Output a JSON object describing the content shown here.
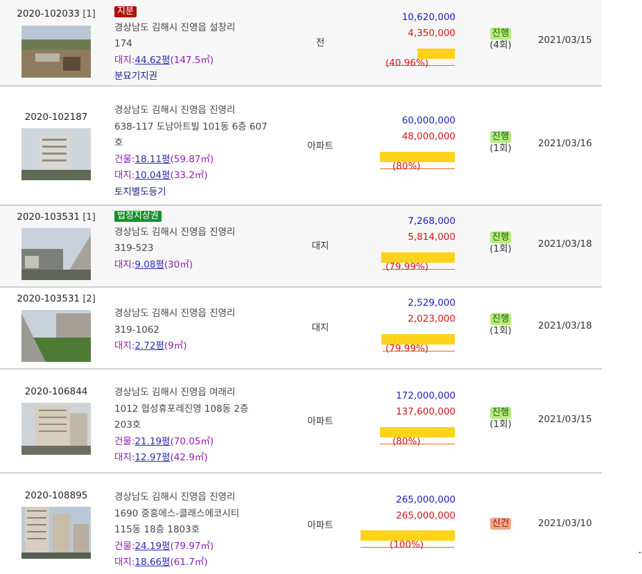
{
  "rows": [
    {
      "case": "2020-102033",
      "case_num": "[1]",
      "tag": "지분",
      "tag_color": "#b30f0f",
      "addr_lines": [
        "경상남도 김해시 진영읍 설창리",
        "174"
      ],
      "building_label": "",
      "building_pyeong": "",
      "building_m2": "",
      "land_label": "대지:",
      "land_pyeong": "44.62평",
      "land_m2": "(147.5㎡)",
      "note": "분묘기지권",
      "type": "전",
      "appraisal": "10,620,000",
      "min_bid": "4,350,000",
      "ratio": "(40.96%)",
      "status": "진행",
      "round": "(4회)",
      "date": "2021/03/15"
    },
    {
      "case": "2020-102187",
      "case_num": "",
      "tag": "",
      "addr_lines": [
        "경상남도 김해시 진영읍 진영리",
        "638-117 도남아트빌 101동 6층 607",
        "호"
      ],
      "building_label": "건물:",
      "building_pyeong": "18.11평",
      "building_m2": "(59.87㎡)",
      "land_label": "대지:",
      "land_pyeong": "10.04평",
      "land_m2": "(33.2㎡)",
      "note": "토지별도등기",
      "type": "아파트",
      "appraisal": "60,000,000",
      "min_bid": "48,000,000",
      "ratio": "(80%)",
      "status": "진행",
      "round": "(1회)",
      "date": "2021/03/16"
    },
    {
      "case": "2020-103531",
      "case_num": "[1]",
      "tag": "법정지상권",
      "tag_color": "#14932c",
      "addr_lines": [
        "경상남도 김해시 진영읍 진영리",
        "319-523"
      ],
      "land_label": "대지:",
      "land_pyeong": "9.08평",
      "land_m2": "(30㎡)",
      "type": "대지",
      "appraisal": "7,268,000",
      "min_bid": "5,814,000",
      "ratio": "(79.99%)",
      "status": "진행",
      "round": "(1회)",
      "date": "2021/03/18"
    },
    {
      "case": "2020-103531",
      "case_num": "[2]",
      "addr_lines": [
        "경상남도 김해시 진영읍 진영리",
        "319-1062"
      ],
      "land_label": "대지:",
      "land_pyeong": "2.72평",
      "land_m2": "(9㎡)",
      "type": "대지",
      "appraisal": "2,529,000",
      "min_bid": "2,023,000",
      "ratio": "(79.99%)",
      "status": "진행",
      "round": "(1회)",
      "date": "2021/03/18"
    },
    {
      "case": "2020-106844",
      "case_num": "",
      "addr_lines": [
        "경상남도 김해시 진영읍 여래리",
        "1012 협성휴포레진영 108동 2층",
        "203호"
      ],
      "building_label": "건물:",
      "building_pyeong": "21.19평",
      "building_m2": "(70.05㎡)",
      "land_label": "대지:",
      "land_pyeong": "12.97평",
      "land_m2": "(42.9㎡)",
      "type": "아파트",
      "appraisal": "172,000,000",
      "min_bid": "137,600,000",
      "ratio": "(80%)",
      "status": "진행",
      "round": "(1회)",
      "date": "2021/03/15"
    },
    {
      "case": "2020-108895",
      "case_num": "",
      "addr_lines": [
        "경상남도 김해시 진영읍 진영리",
        "1690 중흥에스-클래스에코시티",
        "115동 18층 1803호"
      ],
      "building_label": "건물:",
      "building_pyeong": "24.19평",
      "building_m2": "(79.97㎡)",
      "land_label": "대지:",
      "land_pyeong": "18.66평",
      "land_m2": "(61.7㎡)",
      "type": "아파트",
      "appraisal": "265,000,000",
      "min_bid": "265,000,000",
      "ratio": "(100%)",
      "status": "신건",
      "round": "",
      "date": "2021/03/10"
    }
  ],
  "colors": {
    "appraisal": "#1c1cc0",
    "min_bid": "#d51414",
    "bar": "#ffd21c",
    "status_active": "#b7ec76",
    "status_new": "#f3a387"
  }
}
